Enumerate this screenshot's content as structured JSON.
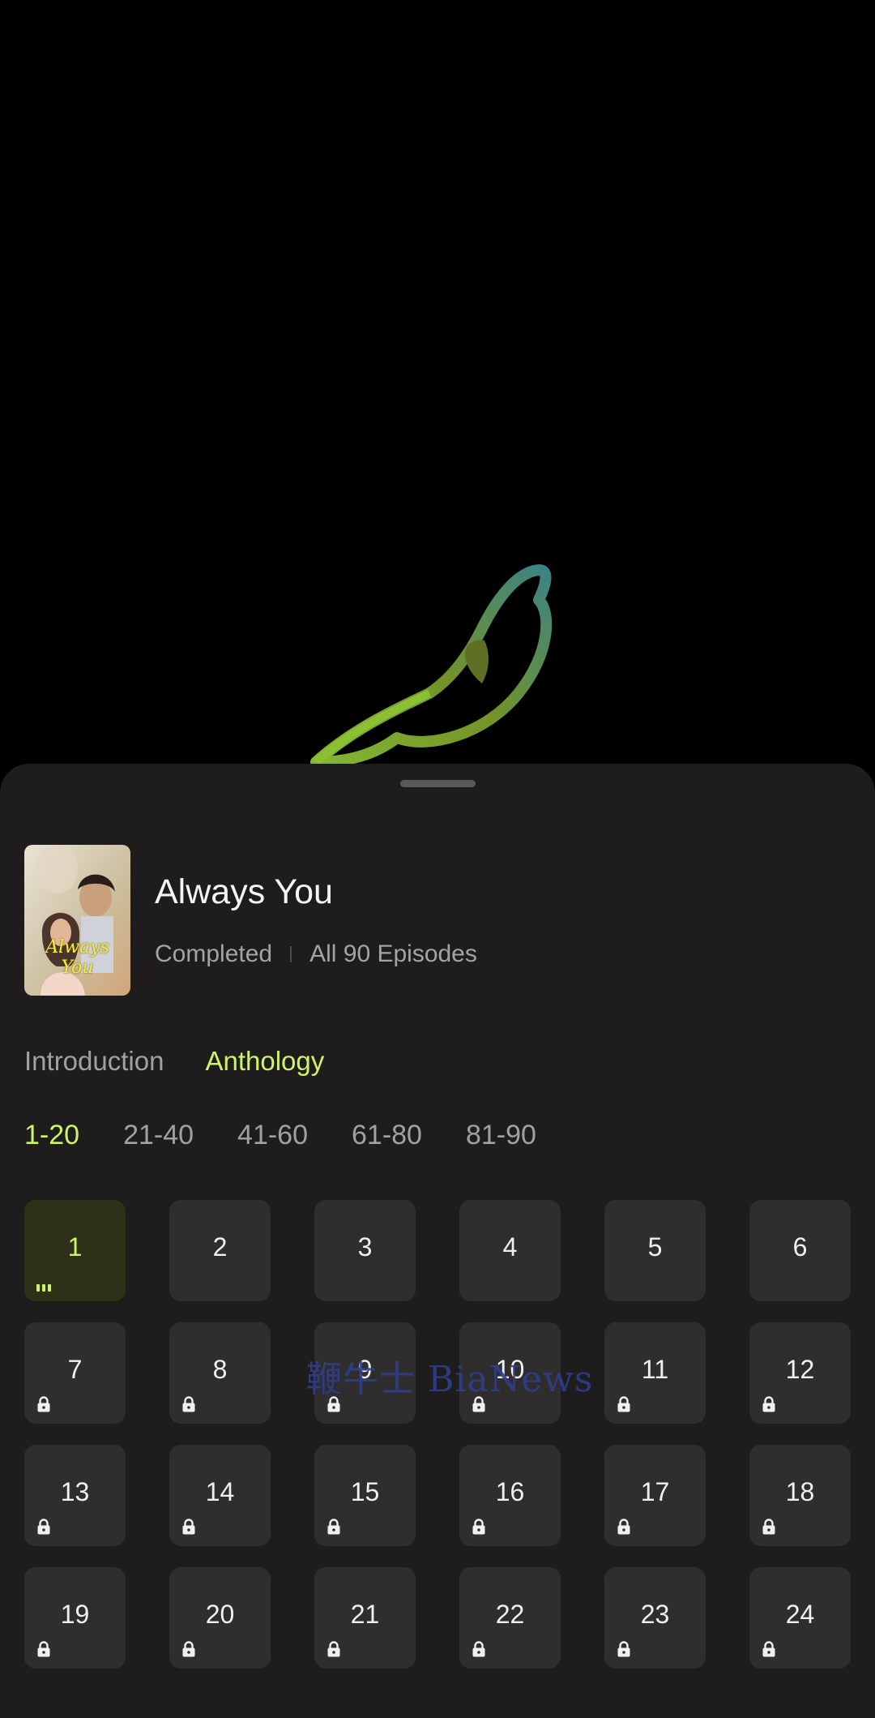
{
  "drama": {
    "title": "Always You",
    "status": "Completed",
    "episodes_total": "All 90 Episodes",
    "poster_text": "Always You"
  },
  "tabs": [
    {
      "label": "Introduction",
      "active": false
    },
    {
      "label": "Anthology",
      "active": true
    }
  ],
  "ranges": [
    {
      "label": "1-20",
      "active": true
    },
    {
      "label": "21-40",
      "active": false
    },
    {
      "label": "41-60",
      "active": false
    },
    {
      "label": "61-80",
      "active": false
    },
    {
      "label": "81-90",
      "active": false
    }
  ],
  "episodes": [
    {
      "n": "1",
      "locked": false,
      "current": true
    },
    {
      "n": "2",
      "locked": false,
      "current": false
    },
    {
      "n": "3",
      "locked": false,
      "current": false
    },
    {
      "n": "4",
      "locked": false,
      "current": false
    },
    {
      "n": "5",
      "locked": false,
      "current": false
    },
    {
      "n": "6",
      "locked": false,
      "current": false
    },
    {
      "n": "7",
      "locked": true,
      "current": false
    },
    {
      "n": "8",
      "locked": true,
      "current": false
    },
    {
      "n": "9",
      "locked": true,
      "current": false
    },
    {
      "n": "10",
      "locked": true,
      "current": false
    },
    {
      "n": "11",
      "locked": true,
      "current": false
    },
    {
      "n": "12",
      "locked": true,
      "current": false
    },
    {
      "n": "13",
      "locked": true,
      "current": false
    },
    {
      "n": "14",
      "locked": true,
      "current": false
    },
    {
      "n": "15",
      "locked": true,
      "current": false
    },
    {
      "n": "16",
      "locked": true,
      "current": false
    },
    {
      "n": "17",
      "locked": true,
      "current": false
    },
    {
      "n": "18",
      "locked": true,
      "current": false
    },
    {
      "n": "19",
      "locked": true,
      "current": false
    },
    {
      "n": "20",
      "locked": true,
      "current": false
    },
    {
      "n": "21",
      "locked": true,
      "current": false
    },
    {
      "n": "22",
      "locked": true,
      "current": false
    },
    {
      "n": "23",
      "locked": true,
      "current": false
    },
    {
      "n": "24",
      "locked": true,
      "current": false
    }
  ],
  "watermark": "鞭牛士 BiaNews",
  "colors": {
    "accent": "#ccf465",
    "sheet_bg": "#1e1c1d",
    "tile_bg": "#2f2d2e"
  }
}
